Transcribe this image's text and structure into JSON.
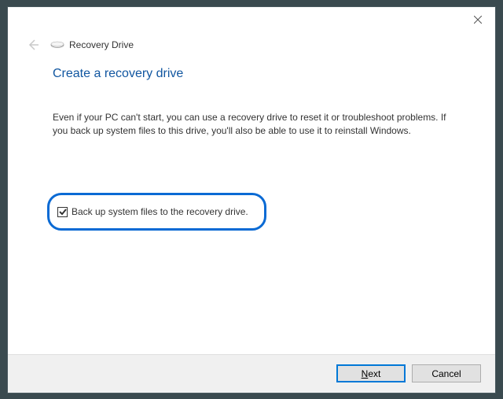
{
  "window": {
    "title": "Recovery Drive"
  },
  "page": {
    "heading": "Create a recovery drive",
    "description": "Even if your PC can't start, you can use a recovery drive to reset it or troubleshoot problems. If you back up system files to this drive, you'll also be able to use it to reinstall Windows."
  },
  "checkbox": {
    "label": "Back up system files to the recovery drive.",
    "checked": true
  },
  "buttons": {
    "next_prefix": "N",
    "next_rest": "ext",
    "cancel": "Cancel"
  }
}
